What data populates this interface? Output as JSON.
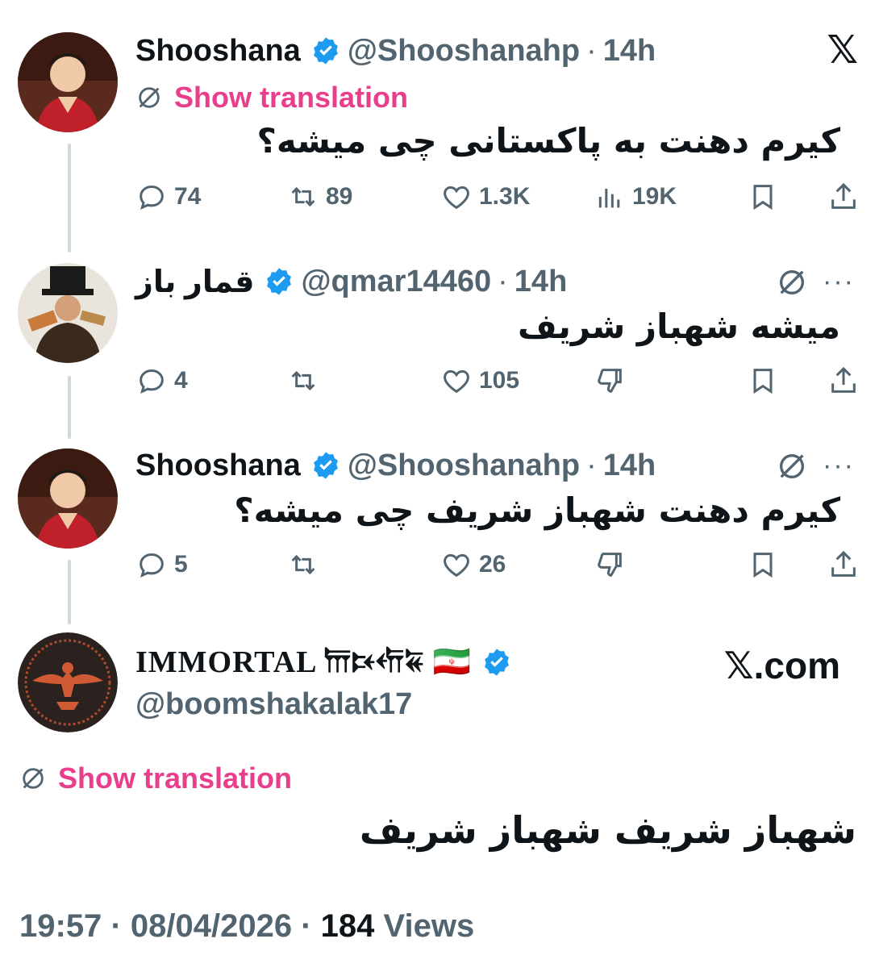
{
  "brand": {
    "x_logo": "𝕏",
    "x_com": "𝕏.com"
  },
  "colors": {
    "accent_pink": "#e83e8c",
    "verified_blue": "#1d9bf0",
    "muted": "#536471"
  },
  "tweets": [
    {
      "name": "Shooshana",
      "handle": "@Shooshanahp",
      "separator": "·",
      "time": "14h",
      "show_translation": "Show translation",
      "text": "کیرم دهنت به پاکستانی چی میشه؟",
      "stats": {
        "replies": "74",
        "reposts": "89",
        "likes": "1.3K",
        "views": "19K"
      }
    },
    {
      "name": "قمار باز",
      "handle": "@qmar14460",
      "separator": "·",
      "time": "14h",
      "text": "میشه شهباز شریف",
      "stats": {
        "replies": "4",
        "reposts": "",
        "likes": "105"
      }
    },
    {
      "name": "Shooshana",
      "handle": "@Shooshanahp",
      "separator": "·",
      "time": "14h",
      "text": "کیرم دهنت شهباز شریف چی میشه؟",
      "stats": {
        "replies": "5",
        "reposts": "",
        "likes": "26"
      }
    },
    {
      "name": "IMMORTAL 𐎠𐎴𐎢𐏁 🇮🇷",
      "handle": "@boomshakalak17",
      "show_translation": "Show translation",
      "text": "شهباز شریف شهباز شریف"
    }
  ],
  "footer": {
    "time": "19:57",
    "separator": "·",
    "date": "08/04/2026",
    "views_count": "184",
    "views_label": "Views"
  }
}
